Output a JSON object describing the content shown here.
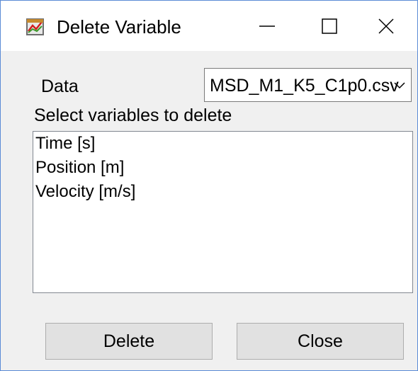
{
  "window": {
    "title": "Delete Variable",
    "icon": "chart-icon"
  },
  "titlebar_controls": {
    "minimize_icon": "minimize-icon",
    "maximize_icon": "maximize-icon",
    "close_icon": "close-icon"
  },
  "data_selector": {
    "label": "Data",
    "selected_value": "MSD_M1_K5_C1p0.csv"
  },
  "variables": {
    "label": "Select variables to delete",
    "items": [
      "Time [s]",
      "Position [m]",
      "Velocity [m/s]"
    ]
  },
  "buttons": {
    "delete_label": "Delete",
    "close_label": "Close"
  },
  "colors": {
    "window_border": "#5b8bd6",
    "dialog_background": "#f0f0f0",
    "button_face": "#e1e1e1"
  }
}
